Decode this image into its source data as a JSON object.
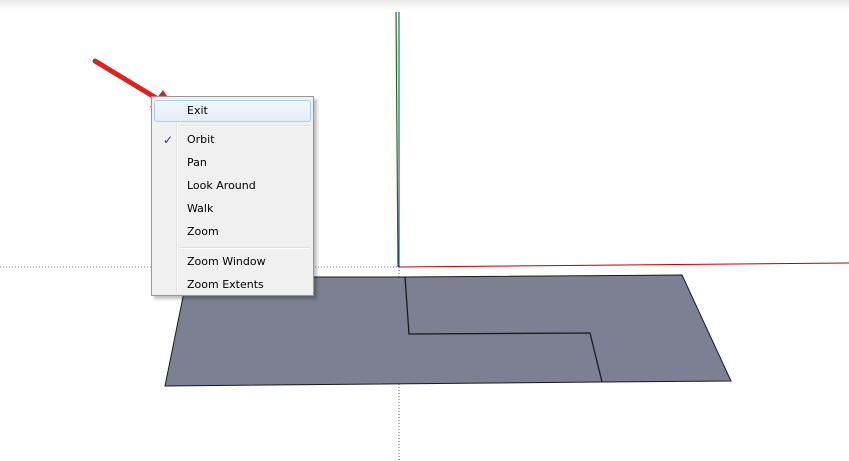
{
  "context_menu": {
    "items": [
      {
        "label": "Exit",
        "checked": false,
        "highlighted": true
      },
      {
        "label": "Orbit",
        "checked": true,
        "highlighted": false
      },
      {
        "label": "Pan",
        "checked": false,
        "highlighted": false
      },
      {
        "label": "Look Around",
        "checked": false,
        "highlighted": false
      },
      {
        "label": "Walk",
        "checked": false,
        "highlighted": false
      },
      {
        "label": "Zoom",
        "checked": false,
        "highlighted": false
      },
      {
        "label": "Zoom Window",
        "checked": false,
        "highlighted": false
      },
      {
        "label": "Zoom Extents",
        "checked": false,
        "highlighted": false
      }
    ],
    "checkmark_glyph": "✓"
  },
  "colors": {
    "face_fill": "#7c8092",
    "edge": "#1a1a1a",
    "red_axis": "#c00000",
    "green_axis": "#008000",
    "blue_axis": "#2020c0",
    "annotation_arrow": "#e0201c"
  },
  "icons": {
    "annotation": "red-arrow-icon",
    "check": "checkmark-icon"
  }
}
